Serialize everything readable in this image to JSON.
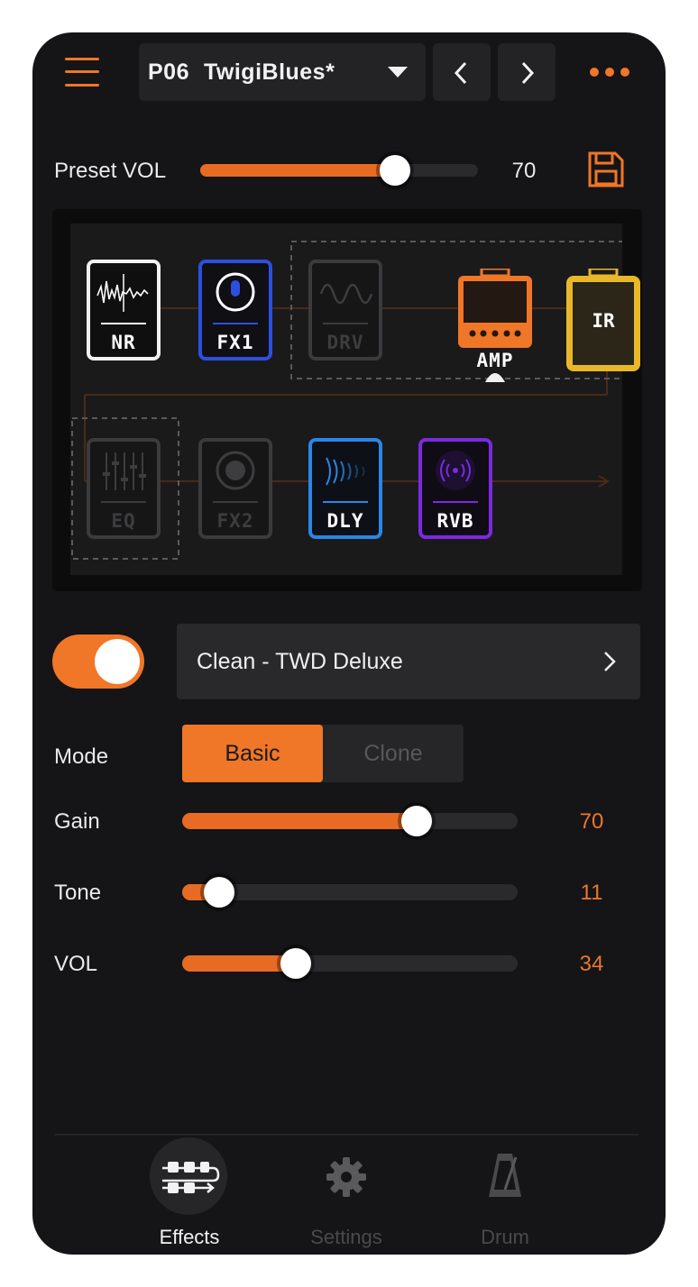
{
  "header": {
    "preset_number": "P06",
    "preset_name": "TwigiBlues*"
  },
  "preset_volume": {
    "label": "Preset VOL",
    "value": "70",
    "level": 0.7
  },
  "signal_chain": {
    "row1": [
      {
        "label": "NR",
        "state": "on",
        "color": "#f1f1f1"
      },
      {
        "label": "FX1",
        "state": "on",
        "color": "#2d4fe0"
      },
      {
        "label": "DRV",
        "state": "off",
        "color": "#3b3b3d"
      },
      {
        "label": "AMP",
        "state": "on",
        "color": "#f07628"
      },
      {
        "label": "IR",
        "state": "on",
        "color": "#e8b72a"
      }
    ],
    "row2": [
      {
        "label": "EQ",
        "state": "off",
        "color": "#3b3b3d"
      },
      {
        "label": "FX2",
        "state": "off",
        "color": "#3b3b3d"
      },
      {
        "label": "DLY",
        "state": "on",
        "color": "#2a86e8"
      },
      {
        "label": "RVB",
        "state": "on",
        "color": "#7b2ae0"
      }
    ]
  },
  "fx_model": {
    "enabled": true,
    "name": "Clean - TWD Deluxe"
  },
  "params": {
    "mode": {
      "label": "Mode",
      "options": [
        "Basic",
        "Clone"
      ],
      "selected": "Basic"
    },
    "gain": {
      "label": "Gain",
      "value": "70",
      "level": 0.7
    },
    "tone": {
      "label": "Tone",
      "value": "11",
      "level": 0.11
    },
    "vol": {
      "label": "VOL",
      "value": "34",
      "level": 0.34
    }
  },
  "tabs": [
    {
      "label": "Effects",
      "icon": "effects-chain-icon",
      "active": true
    },
    {
      "label": "Settings",
      "icon": "gear-icon",
      "active": false
    },
    {
      "label": "Drum",
      "icon": "metronome-icon",
      "active": false
    }
  ],
  "colors": {
    "accent": "#f07628",
    "background": "#151416",
    "inactive_text": "#58575a"
  }
}
